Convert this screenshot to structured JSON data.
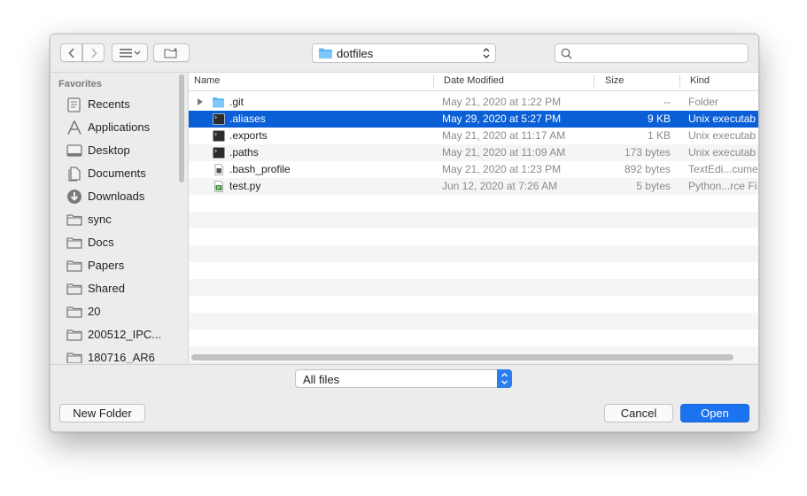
{
  "path": {
    "current": "dotfiles"
  },
  "search": {
    "placeholder": ""
  },
  "sidebar": {
    "section_title": "Favorites",
    "items": [
      {
        "label": "Recents",
        "icon": "clock-icon"
      },
      {
        "label": "Applications",
        "icon": "applications-icon"
      },
      {
        "label": "Desktop",
        "icon": "desktop-icon"
      },
      {
        "label": "Documents",
        "icon": "documents-icon"
      },
      {
        "label": "Downloads",
        "icon": "downloads-icon"
      },
      {
        "label": "sync",
        "icon": "folder-icon"
      },
      {
        "label": "Docs",
        "icon": "folder-icon"
      },
      {
        "label": "Papers",
        "icon": "folder-icon"
      },
      {
        "label": "Shared",
        "icon": "folder-icon"
      },
      {
        "label": "20",
        "icon": "folder-icon"
      },
      {
        "label": "200512_IPC...",
        "icon": "folder-icon"
      },
      {
        "label": "180716_AR6",
        "icon": "folder-icon"
      }
    ]
  },
  "columns": {
    "name": "Name",
    "date": "Date Modified",
    "size": "Size",
    "kind": "Kind"
  },
  "files": [
    {
      "name": ".git",
      "date": "May 21, 2020 at 1:22 PM",
      "size": "--",
      "kind": "Folder",
      "icon": "folder-icon",
      "selected": false
    },
    {
      "name": ".aliases",
      "date": "May 29, 2020 at 5:27 PM",
      "size": "9 KB",
      "kind": "Unix executab",
      "icon": "terminal-icon",
      "selected": true
    },
    {
      "name": ".exports",
      "date": "May 21, 2020 at 11:17 AM",
      "size": "1 KB",
      "kind": "Unix executab",
      "icon": "terminal-icon",
      "selected": false
    },
    {
      "name": ".paths",
      "date": "May 21, 2020 at 11:09 AM",
      "size": "173 bytes",
      "kind": "Unix executab",
      "icon": "terminal-icon",
      "selected": false
    },
    {
      "name": ".bash_profile",
      "date": "May 21, 2020 at 1:23 PM",
      "size": "892 bytes",
      "kind": "TextEdi...cume",
      "icon": "text-document-icon",
      "selected": false
    },
    {
      "name": "test.py",
      "date": "Jun 12, 2020 at 7:26 AM",
      "size": "5 bytes",
      "kind": "Python...rce Fi",
      "icon": "python-file-icon",
      "selected": false
    }
  ],
  "filter": {
    "value": "All files"
  },
  "buttons": {
    "new_folder": "New Folder",
    "cancel": "Cancel",
    "open": "Open"
  },
  "colors": {
    "selection": "#0a5fd6",
    "accent": "#1b73f0"
  }
}
